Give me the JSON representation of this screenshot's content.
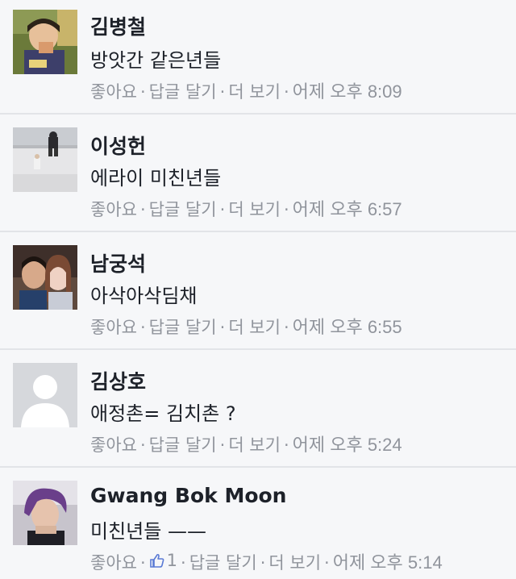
{
  "comments": [
    {
      "avatar_icon": "user-photo-boy-eating",
      "name": "김병철",
      "text": "방앗간 같은년들",
      "like": "좋아요",
      "reply": "답글 달기",
      "more": "더 보기",
      "time": "어제 오후 8:09"
    },
    {
      "avatar_icon": "user-photo-street",
      "name": "이성헌",
      "text": "에라이 미친년들",
      "like": "좋아요",
      "reply": "답글 달기",
      "more": "더 보기",
      "time": "어제 오후 6:57"
    },
    {
      "avatar_icon": "user-photo-couple",
      "name": "남궁석",
      "text": "아삭아삭딤채",
      "like": "좋아요",
      "reply": "답글 달기",
      "more": "더 보기",
      "time": "어제 오후 6:55"
    },
    {
      "avatar_icon": "default-profile-silhouette",
      "name": "김상호",
      "text": "애정촌= 김치촌 ?",
      "like": "좋아요",
      "reply": "답글 달기",
      "more": "더 보기",
      "time": "어제 오후 5:24"
    },
    {
      "avatar_icon": "user-photo-man-purple-hair",
      "name": "Gwang Bok Moon",
      "text": "미친년들 ——",
      "like": "좋아요",
      "like_count": "1",
      "reply": "답글 달기",
      "more": "더 보기",
      "time": "어제 오후 5:14"
    }
  ],
  "separator": "·",
  "colors": {
    "background": "#f6f7f9",
    "name_text": "#1d2129",
    "meta_text": "#90949c",
    "divider": "#e2e4e8"
  }
}
